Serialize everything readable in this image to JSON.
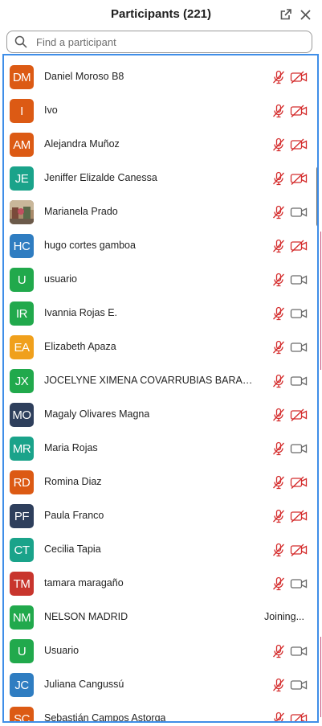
{
  "header": {
    "title": "Participants (221)"
  },
  "search": {
    "placeholder": "Find a participant"
  },
  "colors": {
    "orange": "#dc5a14",
    "teal": "#1aa38a",
    "blue": "#2f7dc1",
    "green": "#21a94c",
    "amber": "#f0a01c",
    "navy": "#2e3f5c",
    "red": "#c8352d",
    "mic_muted": "#d42c2c",
    "icon_gray": "#6a6a6a",
    "list_border": "#3f8ee8"
  },
  "participants": [
    {
      "initials": "DM",
      "name": "Daniel Moroso B8",
      "color": "#dc5a14",
      "mic": "muted",
      "video": "off"
    },
    {
      "initials": "I",
      "name": "Ivo",
      "color": "#dc5a14",
      "mic": "muted",
      "video": "off"
    },
    {
      "initials": "AM",
      "name": "Alejandra Muñoz",
      "color": "#dc5a14",
      "mic": "muted",
      "video": "off"
    },
    {
      "initials": "JE",
      "name": "Jeniffer Elizalde Canessa",
      "color": "#1aa38a",
      "mic": "muted",
      "video": "off"
    },
    {
      "initials": "",
      "name": "Marianela Prado",
      "color": "#8a6a4a",
      "photo": true,
      "mic": "muted",
      "video": "on"
    },
    {
      "initials": "HC",
      "name": "hugo cortes gamboa",
      "color": "#2f7dc1",
      "mic": "muted",
      "video": "off"
    },
    {
      "initials": "U",
      "name": "usuario",
      "color": "#21a94c",
      "mic": "muted",
      "video": "on"
    },
    {
      "initials": "IR",
      "name": "Ivannia Rojas E.",
      "color": "#21a94c",
      "mic": "muted",
      "video": "on"
    },
    {
      "initials": "EA",
      "name": "Elizabeth Apaza",
      "color": "#f0a01c",
      "mic": "muted",
      "video": "on"
    },
    {
      "initials": "JX",
      "name": "JOCELYNE XIMENA COVARRUBIAS BARAHO...",
      "color": "#21a94c",
      "mic": "muted",
      "video": "on"
    },
    {
      "initials": "MO",
      "name": "Magaly Olivares Magna",
      "color": "#2e3f5c",
      "mic": "muted",
      "video": "off"
    },
    {
      "initials": "MR",
      "name": "Maria Rojas",
      "color": "#1aa38a",
      "mic": "muted",
      "video": "on"
    },
    {
      "initials": "RD",
      "name": "Romina Diaz",
      "color": "#dc5a14",
      "mic": "muted",
      "video": "off"
    },
    {
      "initials": "PF",
      "name": "Paula Franco",
      "color": "#2e3f5c",
      "mic": "muted",
      "video": "off"
    },
    {
      "initials": "CT",
      "name": "Cecilia Tapia",
      "color": "#1aa38a",
      "mic": "muted",
      "video": "off"
    },
    {
      "initials": "TM",
      "name": "tamara maragaño",
      "color": "#c8352d",
      "mic": "muted",
      "video": "on"
    },
    {
      "initials": "NM",
      "name": "NELSON MADRID",
      "color": "#21a94c",
      "status": "Joining..."
    },
    {
      "initials": "U",
      "name": "Usuario",
      "color": "#21a94c",
      "mic": "muted",
      "video": "on"
    },
    {
      "initials": "JC",
      "name": "Juliana Cangussú",
      "color": "#2f7dc1",
      "mic": "muted",
      "video": "on"
    },
    {
      "initials": "SC",
      "name": "Sebastián Campos Astorga",
      "color": "#dc5a14",
      "mic": "muted",
      "video": "off"
    }
  ]
}
